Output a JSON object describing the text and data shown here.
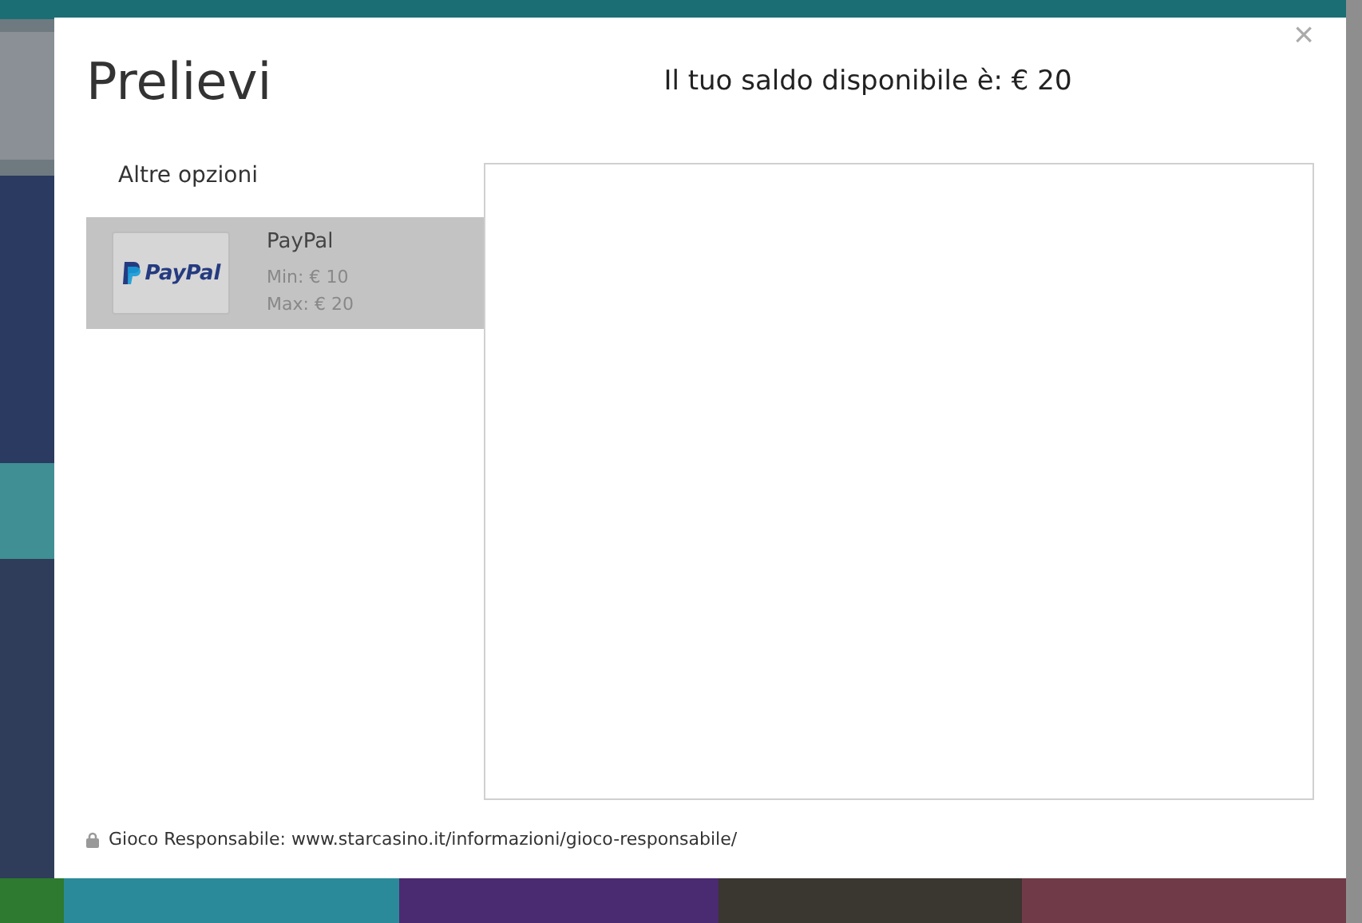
{
  "dialog": {
    "title": "Prelievi",
    "balance": "Il tuo saldo disponibile è: € 20",
    "close": "×"
  },
  "sidebar": {
    "heading": "Altre opzioni",
    "methods": [
      {
        "logo_text": "PayPal",
        "name": "PayPal",
        "min": "Min: € 10",
        "max": "Max: € 20",
        "selected": true
      }
    ]
  },
  "footer": {
    "text": "Gioco Responsabile: www.starcasino.it/informazioni/gioco-responsabile/"
  }
}
